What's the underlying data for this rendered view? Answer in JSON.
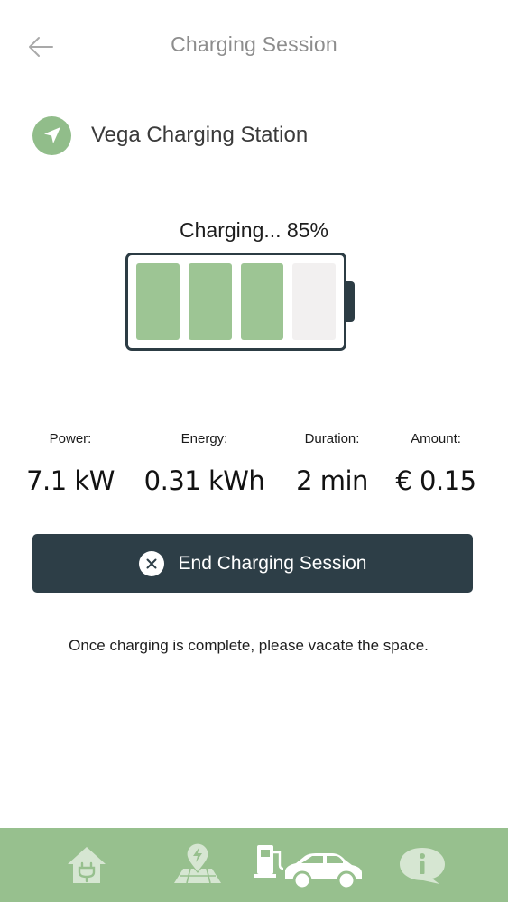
{
  "header": {
    "title": "Charging Session",
    "back_icon": "arrow-left-icon"
  },
  "station": {
    "icon": "navigation-arrow-icon",
    "name": "Vega Charging Station"
  },
  "charging": {
    "status_text": "Charging... 85%",
    "percent": 85,
    "filled_cells": 3,
    "total_cells": 4
  },
  "stats": [
    {
      "label": "Power:",
      "value": "7.1 kW"
    },
    {
      "label": "Energy:",
      "value": "0.31 kWh"
    },
    {
      "label": "Duration:",
      "value": "2 min"
    },
    {
      "label": "Amount:",
      "value": "€ 0.15"
    }
  ],
  "end_button": {
    "icon": "close-circle-icon",
    "label": "End Charging Session"
  },
  "note": "Once charging is complete, please vacate the space.",
  "bottom_nav": [
    {
      "icon": "home-plug-icon",
      "active": false
    },
    {
      "icon": "map-charging-pin-icon",
      "active": false
    },
    {
      "icon": "charger-car-icon",
      "active": true
    },
    {
      "icon": "info-bubble-icon",
      "active": false
    }
  ],
  "colors": {
    "accent_green": "#97c08e",
    "battery_fill": "#9dc594",
    "dark_slate": "#2d3e47",
    "title_gray": "#8d8d8d"
  }
}
